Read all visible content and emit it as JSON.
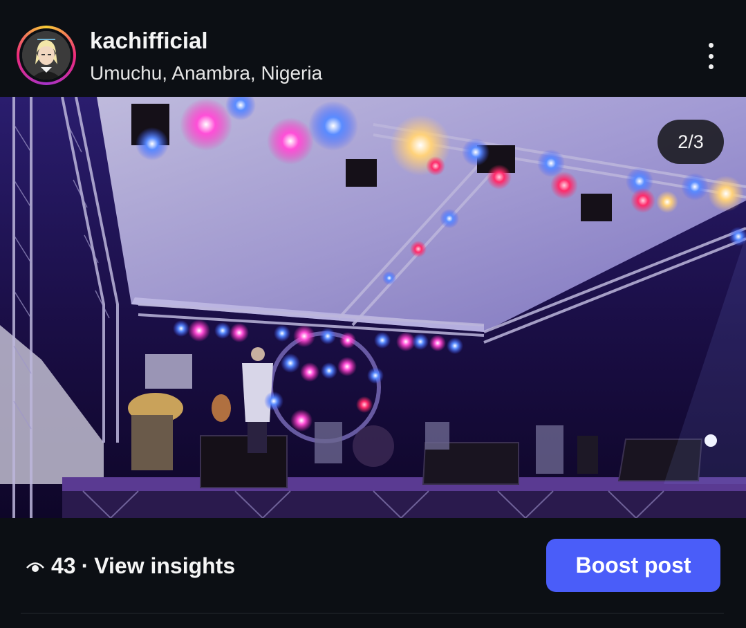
{
  "post_header": {
    "username": "kachifficial",
    "location": "Umuchu, Anambra, Nigeria",
    "avatar_icon": "avatar-illustration",
    "more_icon": "more-vertical-icon"
  },
  "media": {
    "counter": "2/3",
    "description_icon": "concert-stage-photo"
  },
  "footer": {
    "eye_icon": "eye-icon",
    "view_count": "43",
    "separator": "·",
    "insights_label": "View insights",
    "boost_label": "Boost post"
  },
  "colors": {
    "background": "#0c0f14",
    "boost_button": "#4a5df9",
    "counter_bg": "#141418"
  }
}
